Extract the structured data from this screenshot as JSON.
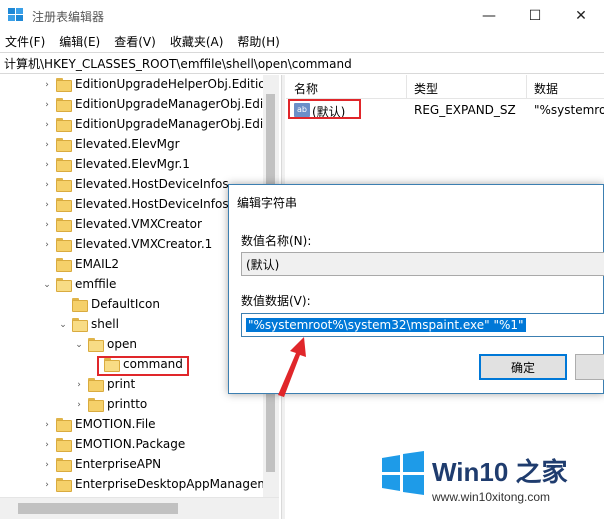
{
  "window": {
    "title": "注册表编辑器",
    "minimize": "—",
    "maximize": "☐",
    "close": "✕"
  },
  "menu": [
    "文件(F)",
    "编辑(E)",
    "查看(V)",
    "收藏夹(A)",
    "帮助(H)"
  ],
  "address": "计算机\\HKEY_CLASSES_ROOT\\emffile\\shell\\open\\command",
  "tree": [
    {
      "label": "EditionUpgradeHelperObj.Editio",
      "expander": "›",
      "open": false
    },
    {
      "label": "EditionUpgradeManagerObj.Edi",
      "expander": "›",
      "open": false
    },
    {
      "label": "EditionUpgradeManagerObj.Edit",
      "expander": "›",
      "open": false
    },
    {
      "label": "Elevated.ElevMgr",
      "expander": "›",
      "open": false
    },
    {
      "label": "Elevated.ElevMgr.1",
      "expander": "›",
      "open": false
    },
    {
      "label": "Elevated.HostDeviceInfos",
      "expander": "›",
      "open": false
    },
    {
      "label": "Elevated.HostDeviceInfos.1",
      "expander": "›",
      "open": false
    },
    {
      "label": "Elevated.VMXCreator",
      "expander": "›",
      "open": false
    },
    {
      "label": "Elevated.VMXCreator.1",
      "expander": "›",
      "open": false
    },
    {
      "label": "EMAIL2",
      "expander": "",
      "open": false
    },
    {
      "label": "emffile",
      "expander": "⌄",
      "open": true
    },
    {
      "label": "DefaultIcon",
      "expander": "",
      "open": false
    },
    {
      "label": "shell",
      "expander": "⌄",
      "open": true
    },
    {
      "label": "open",
      "expander": "⌄",
      "open": true
    },
    {
      "label": "command",
      "expander": "",
      "open": true
    },
    {
      "label": "print",
      "expander": "›",
      "open": false
    },
    {
      "label": "printto",
      "expander": "›",
      "open": false
    },
    {
      "label": "EMOTION.File",
      "expander": "›",
      "open": false
    },
    {
      "label": "EMOTION.Package",
      "expander": "›",
      "open": false
    },
    {
      "label": "EnterpriseAPN",
      "expander": "›",
      "open": false
    },
    {
      "label": "EnterpriseDesktopAppManagem",
      "expander": "›",
      "open": false
    }
  ],
  "list": {
    "columns": [
      "名称",
      "类型",
      "数据"
    ],
    "row": {
      "icon": "ab",
      "name": "(默认)",
      "type": "REG_EXPAND_SZ",
      "data": "\"%systemroo"
    }
  },
  "dialog": {
    "title": "编辑字符串",
    "name_label": "数值名称(N):",
    "name_value": "(默认)",
    "data_label": "数值数据(V):",
    "data_value": "\"%systemroot%\\system32\\mspaint.exe\" \"%1\"",
    "ok_label": "确定",
    "cancel_label": ""
  },
  "watermark": {
    "title": "Win10 之家",
    "url": "www.win10xitong.com"
  },
  "colors": {
    "highlight": "#e0262a",
    "selection": "#0078d7",
    "brand": "#1f3c6e",
    "win_logo": "#1e9be8"
  }
}
